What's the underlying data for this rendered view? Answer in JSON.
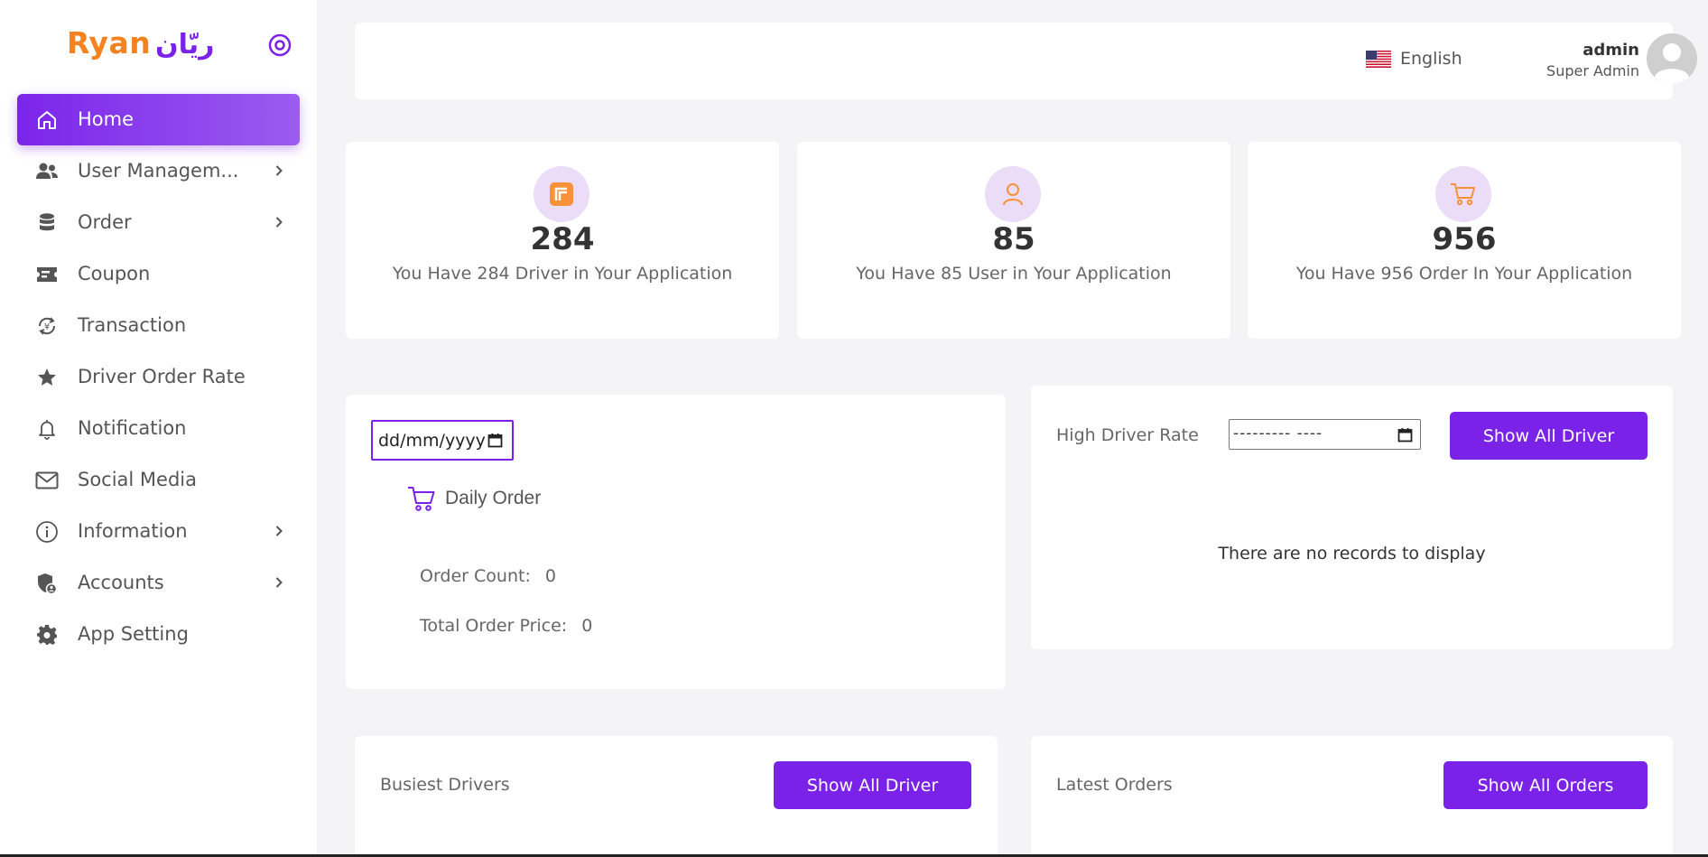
{
  "brand": {
    "latin": "Ryan",
    "arabic": "ريّان"
  },
  "sidebar": {
    "items": [
      {
        "label": "Home",
        "icon": "home-icon",
        "active": true,
        "chevron": false
      },
      {
        "label": "User Managem...",
        "icon": "users-icon",
        "active": false,
        "chevron": true
      },
      {
        "label": "Order",
        "icon": "database-icon",
        "active": false,
        "chevron": true
      },
      {
        "label": "Coupon",
        "icon": "ticket-icon",
        "active": false,
        "chevron": false
      },
      {
        "label": "Transaction",
        "icon": "currency-exchange-icon",
        "active": false,
        "chevron": false
      },
      {
        "label": "Driver Order Rate",
        "icon": "star-icon",
        "active": false,
        "chevron": false
      },
      {
        "label": "Notification",
        "icon": "bell-icon",
        "active": false,
        "chevron": false
      },
      {
        "label": "Social Media",
        "icon": "mail-icon",
        "active": false,
        "chevron": false
      },
      {
        "label": "Information",
        "icon": "info-icon",
        "active": false,
        "chevron": true
      },
      {
        "label": "Accounts",
        "icon": "shield-user-icon",
        "active": false,
        "chevron": true
      },
      {
        "label": "App Setting",
        "icon": "gear-icon",
        "active": false,
        "chevron": false
      }
    ]
  },
  "header": {
    "language": "English",
    "user_name": "admin",
    "user_role": "Super Admin"
  },
  "stats": [
    {
      "value": "284",
      "text": "You Have 284 Driver in Your Application",
      "icon": "driver-icon"
    },
    {
      "value": "85",
      "text": "You Have 85 User in Your Application",
      "icon": "user-icon"
    },
    {
      "value": "956",
      "text": "You Have 956 Order In Your Application",
      "icon": "cart-icon"
    }
  ],
  "daily_order": {
    "date_placeholder": "dd/mm/yyyy",
    "title": "Daily Order",
    "order_count_label": "Order Count:",
    "order_count_value": "0",
    "total_price_label": "Total Order Price:",
    "total_price_value": "0"
  },
  "high_driver_rate": {
    "label": "High Driver Rate",
    "date_placeholder": "--------- ----",
    "button": "Show All Driver",
    "empty_text": "There are no records to display"
  },
  "busiest_drivers": {
    "title": "Busiest Drivers",
    "button": "Show All Driver"
  },
  "latest_orders": {
    "title": "Latest Orders",
    "button": "Show All Orders"
  },
  "colors": {
    "accent": "#7b22e8",
    "brand_orange": "#f5821f",
    "icon_bg": "#ebdcf7"
  }
}
